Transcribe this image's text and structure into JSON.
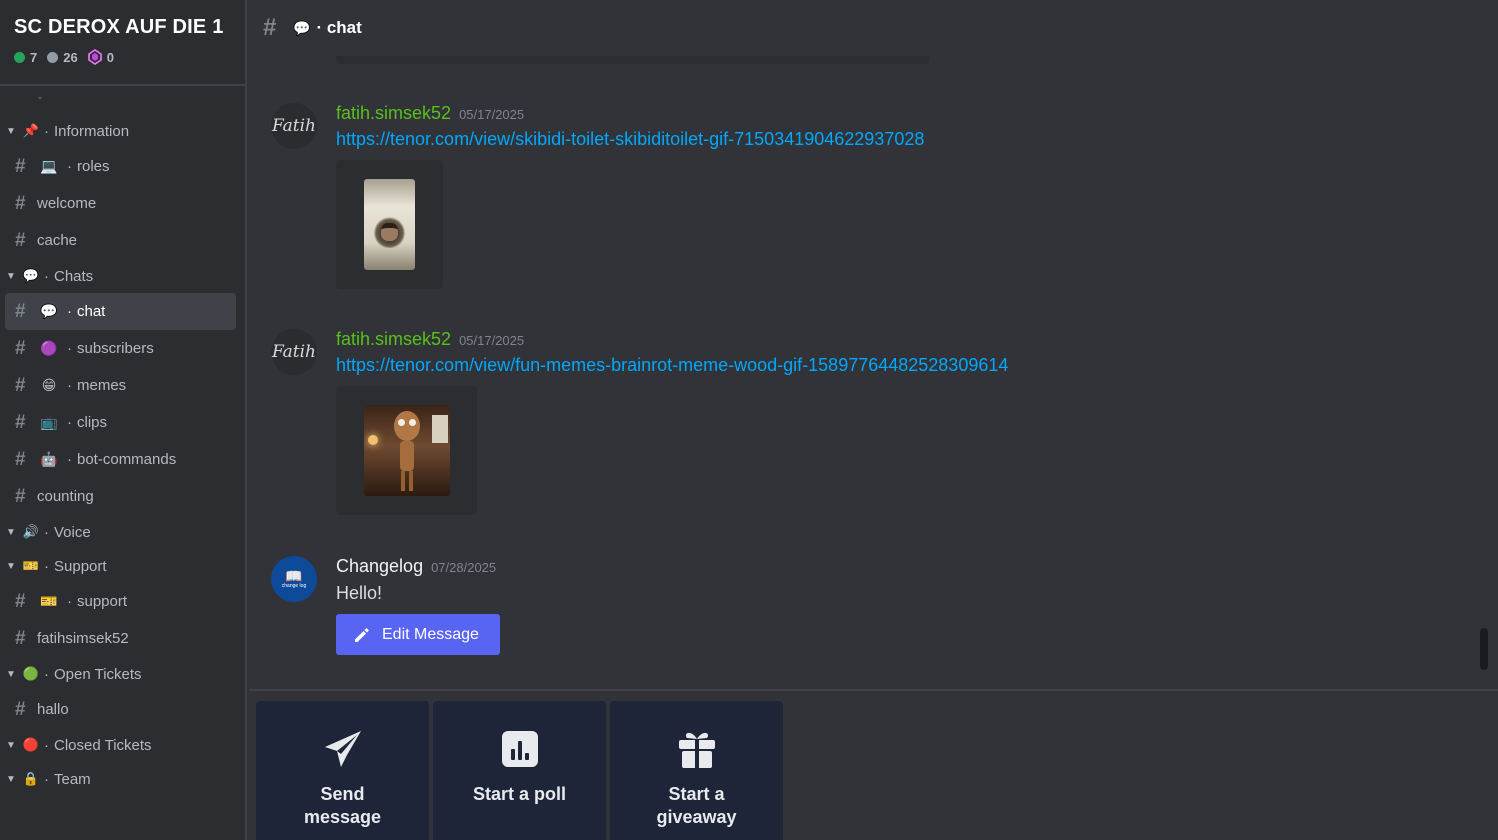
{
  "server": {
    "name": "SC DEROX AUF DIE 1",
    "online": "7",
    "members": "26",
    "boosts": "0"
  },
  "sidebar": {
    "dash": "-",
    "items": [
      {
        "kind": "category",
        "emoji": "📌",
        "label": "Information"
      },
      {
        "kind": "channel",
        "emoji": "💻",
        "label": "roles"
      },
      {
        "kind": "channel",
        "emoji": "",
        "label": "welcome"
      },
      {
        "kind": "channel",
        "emoji": "",
        "label": "cache"
      },
      {
        "kind": "category",
        "emoji": "💬",
        "label": "Chats"
      },
      {
        "kind": "channel",
        "emoji": "💬",
        "label": "chat",
        "active": true
      },
      {
        "kind": "channel",
        "emoji": "🟣",
        "label": "subscribers"
      },
      {
        "kind": "channel",
        "emoji": "😁",
        "label": "memes"
      },
      {
        "kind": "channel",
        "emoji": "📺",
        "label": "clips"
      },
      {
        "kind": "channel",
        "emoji": "🤖",
        "label": "bot-commands"
      },
      {
        "kind": "channel",
        "emoji": "",
        "label": "counting"
      },
      {
        "kind": "category",
        "emoji": "🔊",
        "label": "Voice"
      },
      {
        "kind": "category",
        "emoji": "🎫",
        "label": "Support"
      },
      {
        "kind": "channel",
        "emoji": "🎫",
        "label": "support"
      },
      {
        "kind": "channel",
        "emoji": "",
        "label": "fatihsimsek52"
      },
      {
        "kind": "category",
        "emoji": "🟢",
        "label": "Open Tickets"
      },
      {
        "kind": "channel",
        "emoji": "",
        "label": "hallo"
      },
      {
        "kind": "category",
        "emoji": "🔴",
        "label": "Closed Tickets"
      },
      {
        "kind": "category",
        "emoji": "🔒",
        "label": "Team"
      }
    ]
  },
  "channel": {
    "emoji": "💬",
    "name": "chat"
  },
  "messages": [
    {
      "avatar_text": "Fatih",
      "author": "fatih.simsek52",
      "date": "05/17/2025",
      "link": "https://tenor.com/view/skibidi-toilet-skibiditoilet-gif-7150341904622937028"
    },
    {
      "avatar_text": "Fatih",
      "author": "fatih.simsek52",
      "date": "05/17/2025",
      "link": "https://tenor.com/view/fun-memes-brainrot-meme-wood-gif-15897764482528309614"
    },
    {
      "avatar_text": "change log",
      "author": "Changelog",
      "date": "07/28/2025",
      "text": "Hello!",
      "button": "Edit Message"
    }
  ],
  "actions": [
    {
      "label": "Send message",
      "icon": "paper-plane-icon"
    },
    {
      "label": "Start a poll",
      "icon": "poll-icon"
    },
    {
      "label": "Start a giveaway",
      "icon": "gift-icon"
    }
  ],
  "colors": {
    "accent": "#5865f2",
    "link": "#00a8fc",
    "username": "#57c11a"
  }
}
